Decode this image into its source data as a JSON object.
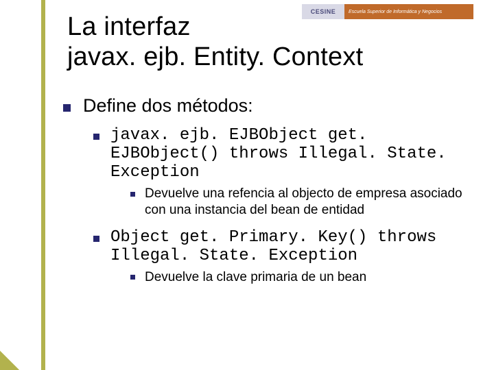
{
  "logo": {
    "left": "CESINE",
    "right": "Escuela Superior de Informática y Negocios"
  },
  "title_line1": "La interfaz",
  "title_line2": "javax. ejb. Entity. Context",
  "l1": "Define dos métodos:",
  "m1": "javax. ejb. EJBObject get. EJBObject() throws Illegal. State. Exception",
  "m1_desc": "Devuelve una refencia al objecto de empresa asociado con una instancia del bean de entidad",
  "m2": "Object get. Primary. Key() throws Illegal. State. Exception",
  "m2_desc": "Devuelve la clave primaria de un bean"
}
